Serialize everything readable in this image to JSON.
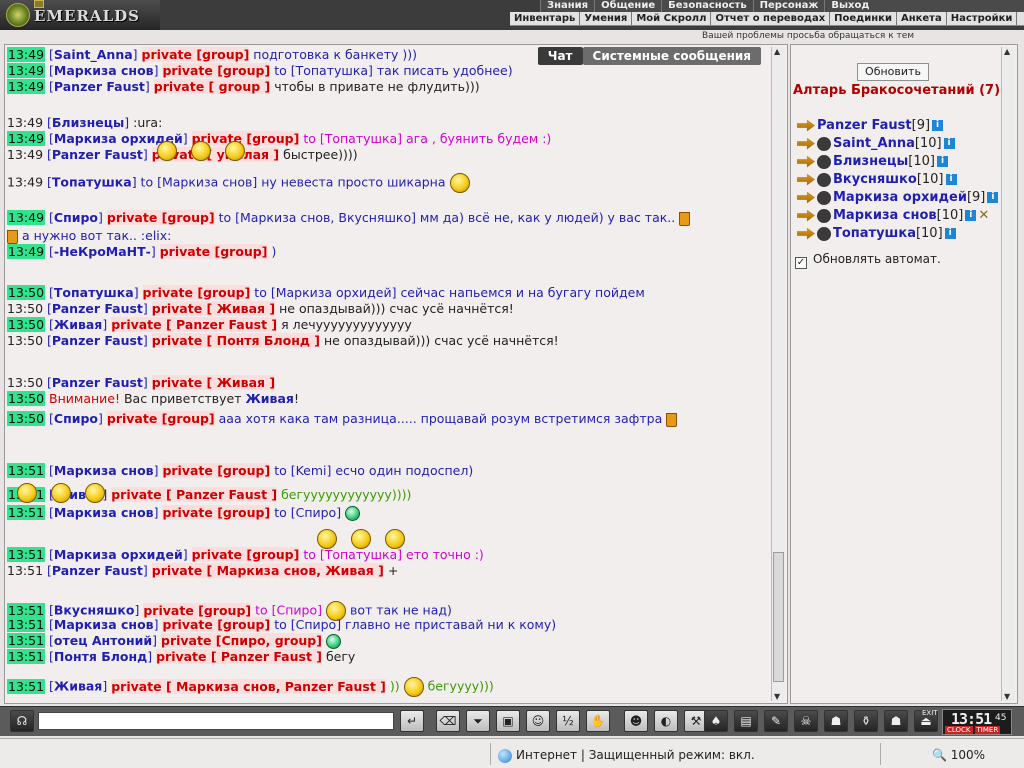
{
  "header": {
    "logo_text": "EMERALDS",
    "top_menu": [
      "Знания",
      "Общение",
      "Безопасность",
      "Персонаж",
      "Выход"
    ],
    "sub_menu": [
      "Инвентарь",
      "Умения",
      "Мой Скролл",
      "Отчет о переводах",
      "Поединки",
      "Анкета",
      "Настройки"
    ],
    "notice": "Вашей проблемы просьба обращаться к тем"
  },
  "chat": {
    "tabs": [
      "Чат",
      "Системные сообщения"
    ],
    "lines": [
      {
        "time": "13:49",
        "time_hl": true,
        "nick": "Saint_Anna",
        "priv": "private [group]",
        "msg": "подготовка к банкету )))",
        "msg_class": "msg"
      },
      {
        "time": "13:49",
        "time_hl": true,
        "nick": "Маркиза снов",
        "priv": "private [group]",
        "msg": "to [Топатушка] так писать удобнее)",
        "msg_class": "msg"
      },
      {
        "time": "13:49",
        "time_hl": true,
        "nick": "Panzer Faust",
        "priv": "private [ group ]",
        "msg": "чтобы в привате не флудить)))",
        "msg_class": "msg-dk"
      },
      {
        "time": "13:49",
        "time_hl": false,
        "nick": "Близнецы",
        "priv": "",
        "msg": ":ura:",
        "msg_class": "msg-dk"
      },
      {
        "time": "13:49",
        "time_hl": true,
        "nick": "Маркиза орхидей",
        "priv": "private [group]",
        "msg": "to [Топатушка] ага , буянить будем :)",
        "msg_class": "msg-pink"
      },
      {
        "time": "13:49",
        "time_hl": false,
        "nick": "Panzer Faust",
        "priv": "private [ умелая ]",
        "msg": "быстрее))))",
        "msg_class": "msg-dk"
      },
      {
        "time": "13:49",
        "time_hl": false,
        "nick": "Топатушка",
        "priv": "",
        "msg": "to [Маркиза снов] ну невеста просто шикарна",
        "msg_class": "msg"
      },
      {
        "time": "13:49",
        "time_hl": true,
        "nick": "Спиро",
        "priv": "private [group]",
        "msg": "to [Маркиза снов, Вкусняшко] мм да) всё не, как у людей) у вас так..",
        "msg_class": "msg"
      },
      {
        "time": "",
        "time_hl": false,
        "nick": "",
        "priv": "",
        "msg": "а нужно вот так..   :elix:",
        "msg_class": "msg"
      },
      {
        "time": "13:49",
        "time_hl": true,
        "nick": "-НеКроМаНТ-",
        "priv": "private [group]",
        "msg": ")",
        "msg_class": "msg"
      },
      {
        "time": "13:50",
        "time_hl": true,
        "nick": "Топатушка",
        "priv": "private [group]",
        "msg": "to [Маркиза орхидей] сейчас напьемся и на бугагу пойдем",
        "msg_class": "msg"
      },
      {
        "time": "13:50",
        "time_hl": false,
        "nick": "Panzer Faust",
        "priv": "private [ Живая ]",
        "msg": "не опаздывай))) счас усё начнётся!",
        "msg_class": "msg-dk"
      },
      {
        "time": "13:50",
        "time_hl": true,
        "nick": "Живая",
        "priv": "private [ Panzer Faust ]",
        "msg": "я лечууууууууууууу",
        "msg_class": "msg-dk"
      },
      {
        "time": "13:50",
        "time_hl": false,
        "nick": "Panzer Faust",
        "priv": "private [ Понтя Блонд ]",
        "msg": "не опаздывай))) счас усё начнётся!",
        "msg_class": "msg-dk"
      },
      {
        "time": "13:50",
        "time_hl": false,
        "nick": "Panzer Faust",
        "priv": "private [ Живая ]",
        "msg": "",
        "msg_class": "msg"
      },
      {
        "time": "13:50",
        "time_hl": true,
        "nick": "",
        "priv": "",
        "msg": "Внимание!",
        "msg_class": "warn",
        "extra": "Вас приветствует",
        "extra_nick": "Живая",
        "extra_tail": "!"
      },
      {
        "time": "13:50",
        "time_hl": true,
        "nick": "Спиро",
        "priv": "private [group]",
        "msg": "ааа хотя кака там разница..... прощавай розум встретимся зафтра",
        "msg_class": "msg"
      },
      {
        "time": "13:51",
        "time_hl": true,
        "nick": "Маркиза снов",
        "priv": "private [group]",
        "msg": "to [Kemi] есчо один подоспел)",
        "msg_class": "msg"
      },
      {
        "time": "13:51",
        "time_hl": true,
        "nick": "Живая",
        "priv": "private [ Panzer Faust ]",
        "msg": "бегуууууууууууу))))",
        "msg_class": "msg-green"
      },
      {
        "time": "13:51",
        "time_hl": true,
        "nick": "Маркиза снов",
        "priv": "private [group]",
        "msg": "to [Спиро]",
        "msg_class": "msg"
      },
      {
        "time": "13:51",
        "time_hl": true,
        "nick": "Маркиза орхидей",
        "priv": "private [group]",
        "msg": "to [Топатушка] ето точно :)",
        "msg_class": "msg-pink"
      },
      {
        "time": "13:51",
        "time_hl": false,
        "nick": "Panzer Faust",
        "priv": "private [ Маркиза снов, Живая ]",
        "msg": "+",
        "msg_class": "msg-dk"
      },
      {
        "time": "13:51",
        "time_hl": true,
        "nick": "Вкусняшко",
        "priv": "private [group]",
        "msg": "to [Спиро]",
        "msg_class": "msg-pink",
        "tail": "вот так не над)"
      },
      {
        "time": "13:51",
        "time_hl": true,
        "nick": "Маркиза снов",
        "priv": "private [group]",
        "msg": "to [Спиро] главно не приставай ни к кому)",
        "msg_class": "msg"
      },
      {
        "time": "13:51",
        "time_hl": true,
        "nick": "отец Антоний",
        "priv": "private [Спиро, group]",
        "msg": "",
        "msg_class": "msg"
      },
      {
        "time": "13:51",
        "time_hl": true,
        "nick": "Понтя Блонд",
        "priv": "private [ Panzer Faust ]",
        "msg": "бегу",
        "msg_class": "msg-dk"
      },
      {
        "time": "13:51",
        "time_hl": true,
        "nick": "Живая",
        "priv": "private [ Маркиза снов, Panzer Faust ]",
        "msg": "))",
        "msg_class": "msg-green",
        "tail": "бегуууу)))"
      }
    ]
  },
  "panel": {
    "refresh_label": "Обновить",
    "room_title": "Алтарь Бракосочетаний (7)",
    "users": [
      {
        "name": "Panzer Faust",
        "level": "[9]",
        "cross": ""
      },
      {
        "name": "Saint_Anna",
        "level": "[10]",
        "cross": ""
      },
      {
        "name": "Близнецы",
        "level": "[10]",
        "cross": ""
      },
      {
        "name": "Вкусняшко",
        "level": "[10]",
        "cross": ""
      },
      {
        "name": "Маркиза орхидей",
        "level": "[9]",
        "cross": ""
      },
      {
        "name": "Маркиза снов",
        "level": "[10]",
        "cross": "✕"
      },
      {
        "name": "Топатушка",
        "level": "[10]",
        "cross": ""
      }
    ],
    "auto_refresh_label": "Обновлять автомат.",
    "auto_refresh_checked": "✓"
  },
  "bottombar": {
    "input_value": "",
    "clock_time": "13:51",
    "clock_seconds": "45",
    "clock_label": "CLOCK",
    "timer_label": "TIMER",
    "exit_label": "EXIT"
  },
  "statusbar": {
    "zone": "Интернет | Защищенный режим: вкл.",
    "zoom": "100%"
  }
}
